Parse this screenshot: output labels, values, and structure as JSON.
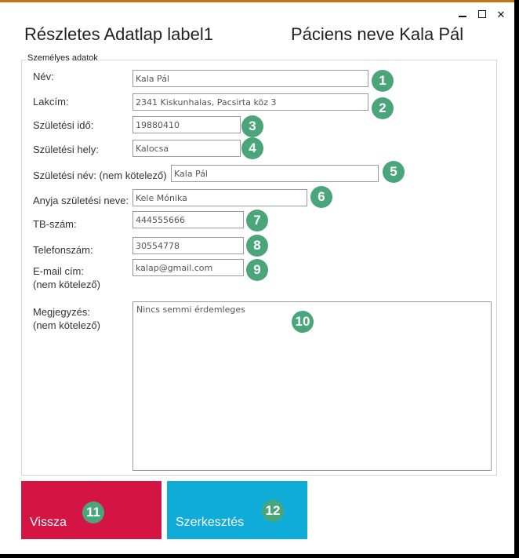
{
  "window": {
    "title_left": "Részletes Adatlap label1",
    "title_right": "Páciens neve Kala Pál",
    "minimize_glyph": "",
    "maximize_glyph": "",
    "close_glyph": "✕",
    "accent_color": "#c6720f"
  },
  "group": {
    "title": "Személyes adatok"
  },
  "fields": {
    "nev": {
      "label": "Név:",
      "value": "Kala Pál",
      "badge": "1"
    },
    "lakcim": {
      "label": "Lakcím:",
      "value": "2341 Kiskunhalas, Pacsirta köz 3",
      "badge": "2"
    },
    "szul_ido": {
      "label": "Születési idő:",
      "value": "19880410",
      "badge": "3"
    },
    "szul_hely": {
      "label": "Születési hely:",
      "value": "Kalocsa",
      "badge": "4"
    },
    "szul_nev": {
      "label": "Születési név: (nem kötelező)",
      "value": "Kala Pál",
      "badge": "5"
    },
    "anyja_nev": {
      "label": "Anyja születési neve:",
      "value": "Kele Mónika",
      "badge": "6"
    },
    "tb_szam": {
      "label": "TB-szám:",
      "value": "444555666",
      "badge": "7"
    },
    "telefon": {
      "label": "Telefonszám:",
      "value": "30554778",
      "badge": "8"
    },
    "email": {
      "label_line1": "E-mail cím:",
      "label_line2": "(nem kötelező)",
      "value": "kalap@gmail.com",
      "badge": "9"
    },
    "megjegyzes": {
      "label_line1": "Megjegyzés:",
      "label_line2": "(nem kötelező)",
      "value": "Nincs semmi érdemleges",
      "badge": "10"
    }
  },
  "buttons": {
    "vissza": {
      "label": "Vissza",
      "badge": "11",
      "color": "#d41544"
    },
    "szerkesztes": {
      "label": "Szerkesztés",
      "badge": "12",
      "color": "#10acd8"
    }
  },
  "badge_color": "#4aa67a"
}
